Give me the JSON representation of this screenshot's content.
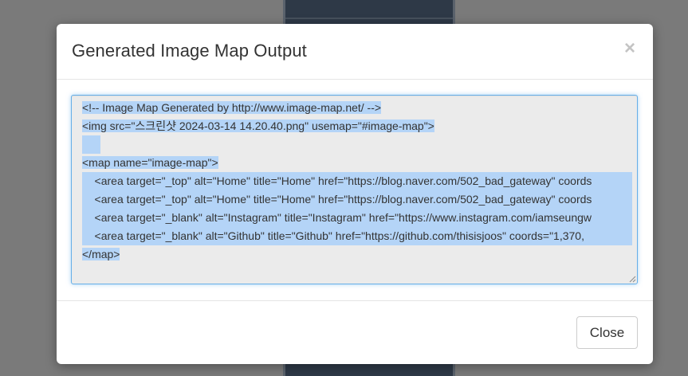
{
  "modal": {
    "title": "Generated Image Map Output",
    "close_symbol": "×",
    "close_icon": "close-icon",
    "footer_close_label": "Close"
  },
  "code": {
    "lines": [
      "<!-- Image Map Generated by http://www.image-map.net/ -->",
      "<img src=\"스크린샷 2024-03-14 14.20.40.png\" usemap=\"#image-map\">",
      "",
      "<map name=\"image-map\">",
      "    <area target=\"_top\" alt=\"Home\" title=\"Home\" href=\"https://blog.naver.com/502_bad_gateway\" coords",
      "    <area target=\"_top\" alt=\"Home\" title=\"Home\" href=\"https://blog.naver.com/502_bad_gateway\" coords",
      "    <area target=\"_blank\" alt=\"Instagram\" title=\"Instagram\" href=\"https://www.instagram.com/iamseungw",
      "    <area target=\"_blank\" alt=\"Github\" title=\"Github\" href=\"https://github.com/thisisjoos\" coords=\"1,370,",
      "</map>"
    ]
  },
  "colors": {
    "selection": "#b4d4f7",
    "focus_border": "#66afe9",
    "textarea_bg": "#ebebeb",
    "backdrop": "#7a7a7a"
  }
}
